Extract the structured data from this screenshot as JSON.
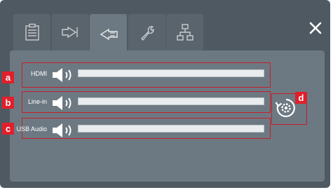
{
  "tabs": [
    {
      "icon": "clipboard-icon"
    },
    {
      "icon": "output-arrow-icon"
    },
    {
      "icon": "input-arrow-icon",
      "active": true
    },
    {
      "icon": "wrench-icon"
    },
    {
      "icon": "network-icon"
    }
  ],
  "close_icon": "close-icon",
  "inputs": [
    {
      "label": "HDMI",
      "callout": "a"
    },
    {
      "label": "Line-in",
      "callout": "b"
    },
    {
      "label": "USB Audio",
      "callout": "c"
    }
  ],
  "reset": {
    "icon": "reset-gear-icon",
    "callout": "d"
  },
  "colors": {
    "panel": "#4f5962",
    "content": "#6d7982",
    "callout": "#e11f2b",
    "outline": "#c41e2a"
  }
}
